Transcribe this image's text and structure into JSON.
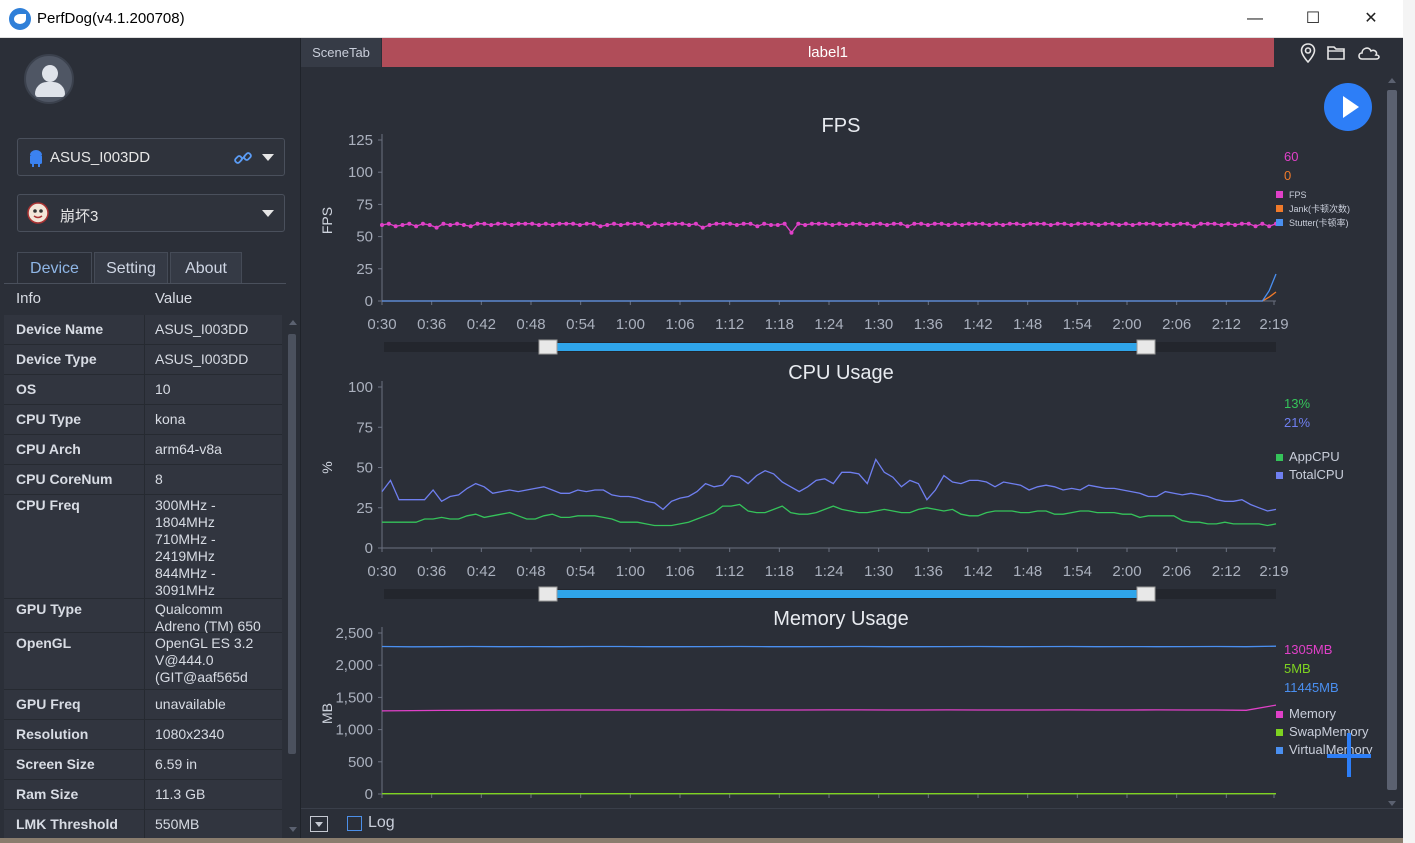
{
  "window": {
    "title": "PerfDog(v4.1.200708)",
    "minimize_glyph": "—",
    "maximize_glyph": "☐",
    "close_glyph": "✕"
  },
  "sidebar": {
    "device_select": {
      "label": "ASUS_I003DD",
      "icon": "android-icon"
    },
    "app_select": {
      "label": "崩坏3",
      "icon": "app-icon"
    },
    "tabs": [
      {
        "label": "Device"
      },
      {
        "label": "Setting"
      },
      {
        "label": "About"
      }
    ],
    "table_header": {
      "key": "Info",
      "value": "Value"
    },
    "rows": [
      {
        "key": "Device Name",
        "value": "ASUS_I003DD"
      },
      {
        "key": "Device Type",
        "value": "ASUS_I003DD"
      },
      {
        "key": "OS",
        "value": "10"
      },
      {
        "key": "CPU Type",
        "value": "kona"
      },
      {
        "key": "CPU Arch",
        "value": "arm64-v8a"
      },
      {
        "key": "CPU CoreNum",
        "value": "8"
      },
      {
        "key": "CPU Freq",
        "value": "300MHz -\n1804MHz\n710MHz -\n2419MHz\n844MHz -\n3091MHz"
      },
      {
        "key": "GPU Type",
        "value": "Qualcomm\nAdreno (TM) 650"
      },
      {
        "key": "OpenGL",
        "value": "OpenGL ES 3.2\nV@444.0\n(GIT@aaf565d"
      },
      {
        "key": "GPU Freq",
        "value": "unavailable"
      },
      {
        "key": "Resolution",
        "value": "1080x2340"
      },
      {
        "key": "Screen Size",
        "value": "6.59 in"
      },
      {
        "key": "Ram Size",
        "value": "11.3 GB"
      },
      {
        "key": "LMK Threshold",
        "value": "550MB"
      }
    ]
  },
  "main": {
    "scene_tab": "SceneTab",
    "label_bar": "label1",
    "bottom": {
      "log_label": "Log"
    }
  },
  "colors": {
    "fps": "#e040c8",
    "jank": "#f07a2a",
    "stutter": "#4a8ff0",
    "appcpu": "#35c35a",
    "totalcpu": "#6f7ff0",
    "memory": "#e040c8",
    "swap": "#7ed321",
    "virtual": "#4a8ff0",
    "accent": "#2d7ef7"
  },
  "chart_data": [
    {
      "type": "line",
      "title": "FPS",
      "ylabel": "FPS",
      "ylim": [
        0,
        125
      ],
      "yticks": [
        "0",
        "25",
        "50",
        "75",
        "100",
        "125"
      ],
      "xticks": [
        "0:30",
        "0:36",
        "0:42",
        "0:48",
        "0:54",
        "1:00",
        "1:06",
        "1:12",
        "1:18",
        "1:24",
        "1:30",
        "1:36",
        "1:42",
        "1:48",
        "1:54",
        "2:00",
        "2:06",
        "2:12",
        "2:19"
      ],
      "current_values": [
        "60",
        "0"
      ],
      "series": [
        {
          "name": "FPS",
          "values": [
            59,
            60,
            58,
            59,
            60,
            58,
            60,
            59,
            57,
            60,
            59,
            60,
            59,
            58,
            60,
            60,
            59,
            60,
            60,
            59,
            60,
            60,
            60,
            59,
            60,
            59,
            60,
            60,
            60,
            59,
            60,
            60,
            58,
            59,
            60,
            59,
            60,
            60,
            60,
            58,
            60,
            59,
            60,
            60,
            60,
            59,
            60,
            57,
            59,
            60,
            60,
            60,
            59,
            60,
            60,
            58,
            60,
            59,
            59,
            60,
            53,
            60,
            59,
            60,
            60,
            60,
            59,
            60,
            59,
            60,
            60,
            59,
            60,
            60,
            59,
            60,
            60,
            58,
            60,
            60,
            59,
            60,
            60,
            59,
            60,
            59,
            60,
            60,
            60,
            59,
            60,
            59,
            60,
            60,
            59,
            60,
            60,
            60,
            59,
            60,
            60,
            59,
            60,
            60,
            60,
            59,
            60,
            60,
            59,
            60,
            59,
            60,
            60,
            60,
            59,
            60,
            59,
            60,
            60,
            58,
            60,
            60,
            60,
            59,
            60,
            59,
            60,
            60,
            58,
            60,
            58,
            60
          ]
        },
        {
          "name": "Jank(卡顿次数)",
          "values": [
            0,
            0,
            0,
            0,
            0,
            0,
            0,
            0,
            0,
            0,
            0,
            0,
            0,
            0,
            0,
            0,
            0,
            0,
            0,
            0,
            0,
            0,
            0,
            0,
            0,
            0,
            0,
            0,
            0,
            0,
            0,
            0,
            0,
            0,
            0,
            0,
            0,
            0,
            0,
            0,
            0,
            0,
            0,
            0,
            0,
            0,
            0,
            0,
            0,
            0,
            0,
            0,
            0,
            0,
            0,
            0,
            0,
            0,
            0,
            0,
            0,
            0,
            0,
            0,
            0,
            0,
            0,
            0,
            0,
            0,
            0,
            0,
            0,
            0,
            0,
            0,
            0,
            0,
            0,
            0,
            0,
            0,
            0,
            0,
            0,
            0,
            0,
            0,
            0,
            0,
            0,
            0,
            0,
            0,
            0,
            0,
            0,
            0,
            0,
            0,
            0,
            0,
            0,
            0,
            0,
            0,
            0,
            0,
            0,
            0,
            0,
            0,
            0,
            0,
            0,
            0,
            0,
            0,
            0,
            0,
            0,
            0,
            0,
            0,
            0,
            0,
            0,
            0,
            0,
            0,
            3,
            7
          ]
        },
        {
          "name": "Stutter(卡顿率)",
          "values": [
            0,
            0,
            0,
            0,
            0,
            0,
            0,
            0,
            0,
            0,
            0,
            0,
            0,
            0,
            0,
            0,
            0,
            0,
            0,
            0,
            0,
            0,
            0,
            0,
            0,
            0,
            0,
            0,
            0,
            0,
            0,
            0,
            0,
            0,
            0,
            0,
            0,
            0,
            0,
            0,
            0,
            0,
            0,
            0,
            0,
            0,
            0,
            0,
            0,
            0,
            0,
            0,
            0,
            0,
            0,
            0,
            0,
            0,
            0,
            0,
            0,
            0,
            0,
            0,
            0,
            0,
            0,
            0,
            0,
            0,
            0,
            0,
            0,
            0,
            0,
            0,
            0,
            0,
            0,
            0,
            0,
            0,
            0,
            0,
            0,
            0,
            0,
            0,
            0,
            0,
            0,
            0,
            0,
            0,
            0,
            0,
            0,
            0,
            0,
            0,
            0,
            0,
            0,
            0,
            0,
            0,
            0,
            0,
            0,
            0,
            0,
            0,
            0,
            0,
            0,
            0,
            0,
            0,
            0,
            0,
            0,
            0,
            0,
            0,
            0,
            0,
            0,
            0,
            0,
            0,
            8,
            21
          ]
        }
      ]
    },
    {
      "type": "line",
      "title": "CPU Usage",
      "ylabel": "%",
      "ylim": [
        0,
        100
      ],
      "yticks": [
        "0",
        "25",
        "50",
        "75",
        "100"
      ],
      "xticks": [
        "0:30",
        "0:36",
        "0:42",
        "0:48",
        "0:54",
        "1:00",
        "1:06",
        "1:12",
        "1:18",
        "1:24",
        "1:30",
        "1:36",
        "1:42",
        "1:48",
        "1:54",
        "2:00",
        "2:06",
        "2:12",
        "2:19"
      ],
      "current_values": [
        "13%",
        "21%"
      ],
      "series": [
        {
          "name": "AppCPU",
          "values": [
            16,
            16,
            16,
            16,
            16,
            18,
            18,
            19,
            18,
            18,
            20,
            21,
            19,
            20,
            21,
            22,
            20,
            18,
            18,
            20,
            21,
            19,
            19,
            20,
            20,
            20,
            19,
            18,
            16,
            16,
            16,
            15,
            14,
            14,
            14,
            15,
            16,
            18,
            20,
            22,
            26,
            26,
            27,
            23,
            22,
            22,
            24,
            26,
            22,
            21,
            21,
            22,
            24,
            26,
            24,
            23,
            22,
            22,
            23,
            24,
            23,
            22,
            22,
            24,
            25,
            24,
            23,
            24,
            21,
            20,
            20,
            22,
            23,
            23,
            23,
            22,
            22,
            23,
            23,
            21,
            21,
            22,
            23,
            23,
            22,
            22,
            22,
            21,
            21,
            19,
            20,
            20,
            20,
            20,
            17,
            16,
            16,
            15,
            15,
            16,
            15,
            15,
            15,
            15,
            14,
            15
          ]
        },
        {
          "name": "TotalCPU",
          "values": [
            35,
            42,
            30,
            30,
            30,
            30,
            36,
            29,
            32,
            33,
            37,
            40,
            38,
            34,
            35,
            36,
            35,
            36,
            37,
            38,
            36,
            34,
            34,
            36,
            35,
            36,
            36,
            33,
            32,
            32,
            31,
            29,
            28,
            24,
            29,
            31,
            32,
            35,
            40,
            38,
            39,
            45,
            44,
            40,
            45,
            48,
            46,
            41,
            38,
            35,
            38,
            42,
            43,
            40,
            47,
            47,
            46,
            40,
            55,
            47,
            44,
            38,
            42,
            40,
            30,
            36,
            45,
            41,
            40,
            42,
            42,
            41,
            38,
            41,
            40,
            39,
            36,
            38,
            39,
            38,
            36,
            37,
            36,
            39,
            38,
            37,
            37,
            36,
            35,
            34,
            32,
            32,
            35,
            34,
            33,
            34,
            33,
            32,
            30,
            29,
            29,
            30,
            27,
            25,
            23,
            24
          ]
        }
      ]
    },
    {
      "type": "line",
      "title": "Memory Usage",
      "ylabel": "MB",
      "ylim": [
        0,
        2500
      ],
      "yticks": [
        "0",
        "500",
        "1,000",
        "1,500",
        "2,000",
        "2,500"
      ],
      "xticks": [
        "0:30",
        "0:36",
        "0:42",
        "0:48",
        "0:54",
        "1:00",
        "1:06",
        "1:12",
        "1:18",
        "1:24",
        "1:30",
        "1:36",
        "1:42",
        "1:48",
        "1:54",
        "2:00",
        "2:06",
        "2:12",
        "2:19"
      ],
      "current_values": [
        "1305MB",
        "5MB",
        "11445MB"
      ],
      "series": [
        {
          "name": "Memory",
          "values": [
            1290,
            1295,
            1298,
            1300,
            1302,
            1303,
            1305,
            1305,
            1305,
            1304,
            1305,
            1306,
            1305,
            1305,
            1305,
            1306,
            1306,
            1305,
            1305,
            1306,
            1305,
            1305,
            1305,
            1306,
            1305,
            1305,
            1306,
            1305,
            1305,
            1300,
            1380
          ]
        },
        {
          "name": "SwapMemory",
          "values": [
            5,
            5,
            5,
            5,
            5,
            5,
            5,
            5,
            5,
            5,
            5,
            5,
            5,
            5,
            5,
            5,
            5,
            5,
            5,
            5,
            5,
            5,
            5,
            5,
            5,
            5,
            5,
            5,
            5,
            5,
            5
          ]
        },
        {
          "name": "VirtualMemory",
          "values": [
            2290,
            2285,
            2288,
            2290,
            2287,
            2289,
            2288,
            2290,
            2291,
            2288,
            2287,
            2289,
            2290,
            2288,
            2287,
            2289,
            2290,
            2288,
            2287,
            2289,
            2290,
            2288,
            2289,
            2290,
            2288,
            2289,
            2287,
            2289,
            2290,
            2288,
            2295
          ]
        }
      ]
    }
  ]
}
